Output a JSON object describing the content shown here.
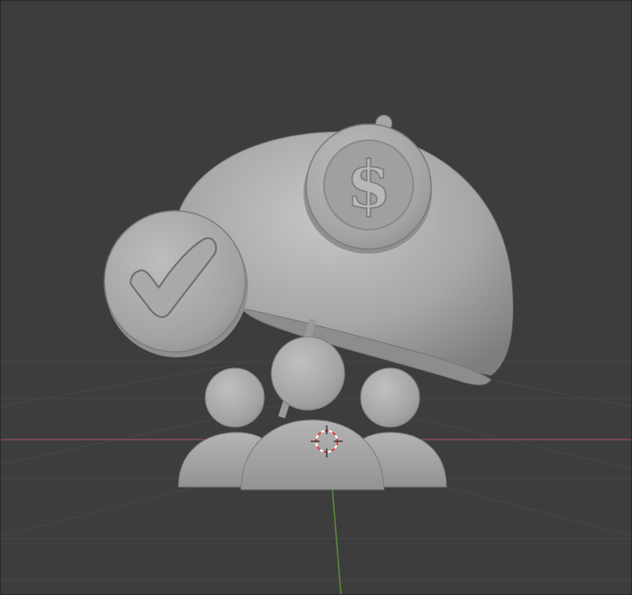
{
  "viewport": {
    "name": "3d-viewport",
    "background": "#3d3d3d",
    "grid_color": "#4a4a4a",
    "x_axis_color": "#8a4a55",
    "y_axis_color": "#5e8a36"
  },
  "model": {
    "description_icon": "umbrella-dollar-coin-checkmark-people",
    "material_color": "#a9a9a9",
    "coin_symbol": "$"
  },
  "cursor_3d": {
    "name": "3d-cursor"
  }
}
